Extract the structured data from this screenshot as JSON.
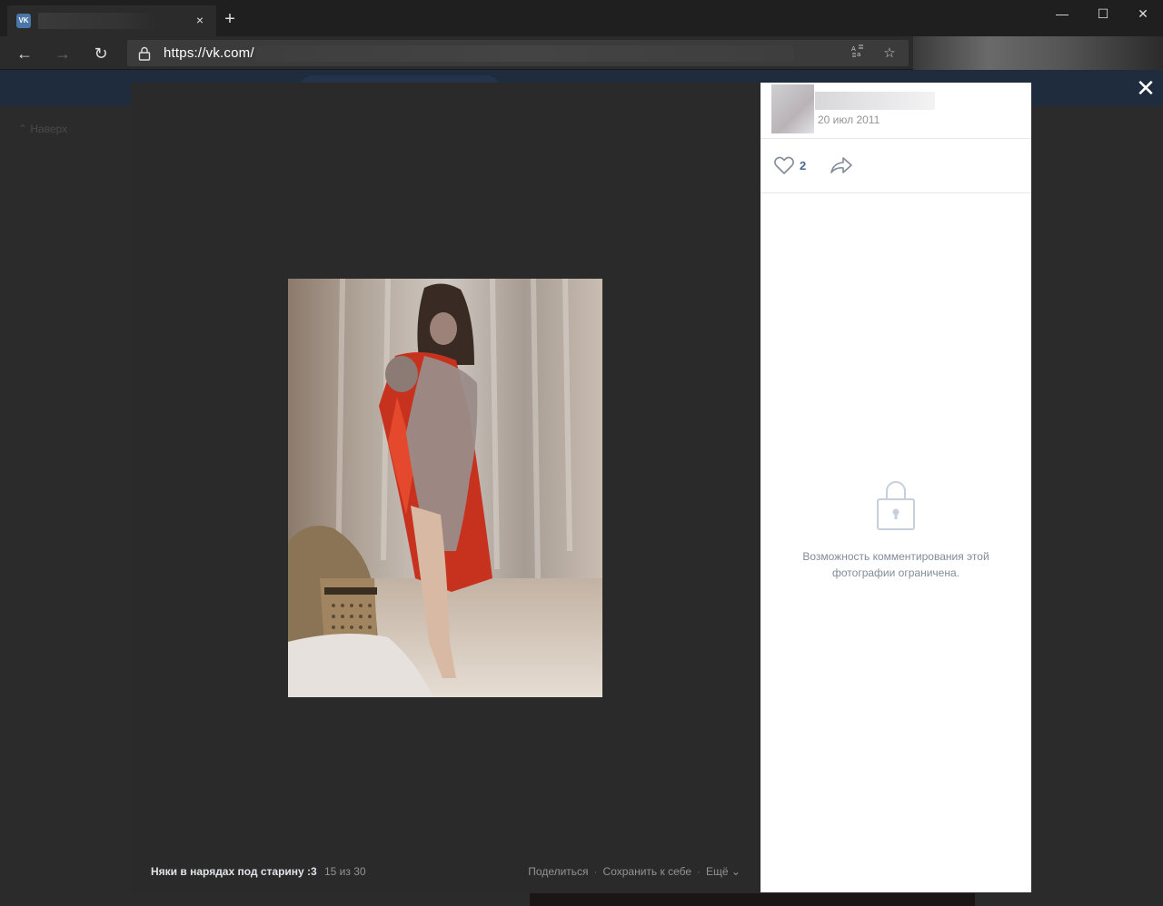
{
  "browser": {
    "tab": {
      "favicon": "VK",
      "title": "",
      "close": "×"
    },
    "new_tab": "+",
    "window_controls": {
      "minimize": "—",
      "maximize": "☐",
      "close": "✕"
    },
    "nav": {
      "back": "←",
      "forward": "→",
      "reload": "↻"
    },
    "address": {
      "url": "https://vk.com/"
    },
    "address_icons": {
      "reader": "reader-view-icon",
      "favorite": "☆"
    }
  },
  "background": {
    "up_link": "Наверх"
  },
  "viewer": {
    "album_title": "Няки в нарядах под старину :3",
    "counter": "15 из 30",
    "actions": [
      "Поделиться",
      "Сохранить к себе",
      "Ещё ⌄"
    ],
    "close": "✕"
  },
  "side_panel": {
    "date": "20 июл 2011",
    "likes": "2",
    "restricted_message": "Возможность комментирования этой фотографии ограничена."
  },
  "colors": {
    "accent": "#4a76a8",
    "like": "#45678f"
  }
}
